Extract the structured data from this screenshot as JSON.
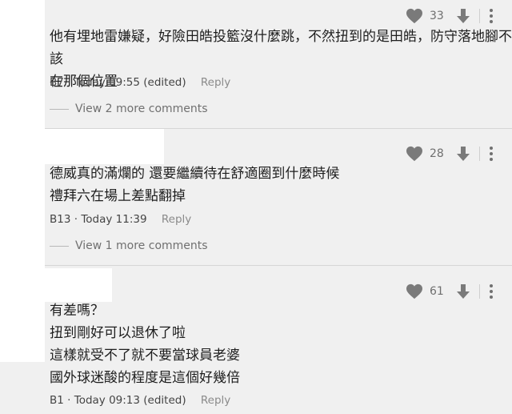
{
  "comments": [
    {
      "likes": "33",
      "lines": [
        "他有埋地雷嫌疑，好險田皓投籃沒什麼跳，不然扭到的是田皓，防守落地腳不該",
        "在那個位置"
      ],
      "floor": "B7",
      "time": "Today 09:55 (edited)",
      "reply": "Reply",
      "more_comments": "View 2 more comments"
    },
    {
      "likes": "28",
      "lines": [
        "德威真的滿爛的 還要繼續待在舒適圈到什麼時候",
        "禮拜六在場上差點翻掉"
      ],
      "floor": "B13",
      "time": "Today 11:39",
      "reply": "Reply",
      "more_comments": "View 1 more comments"
    },
    {
      "likes": "61",
      "lines": [
        "有差嗎？",
        "扭到剛好可以退休了啦",
        "這樣就受不了就不要當球員老婆",
        "國外球迷酸的程度是這個好幾倍"
      ],
      "floor": "B1",
      "time": "Today 09:13 (edited)",
      "reply": "Reply"
    }
  ],
  "icons": {
    "like": "heart-icon",
    "dislike": "down-arrow-icon",
    "menu": "more-vertical-icon"
  }
}
